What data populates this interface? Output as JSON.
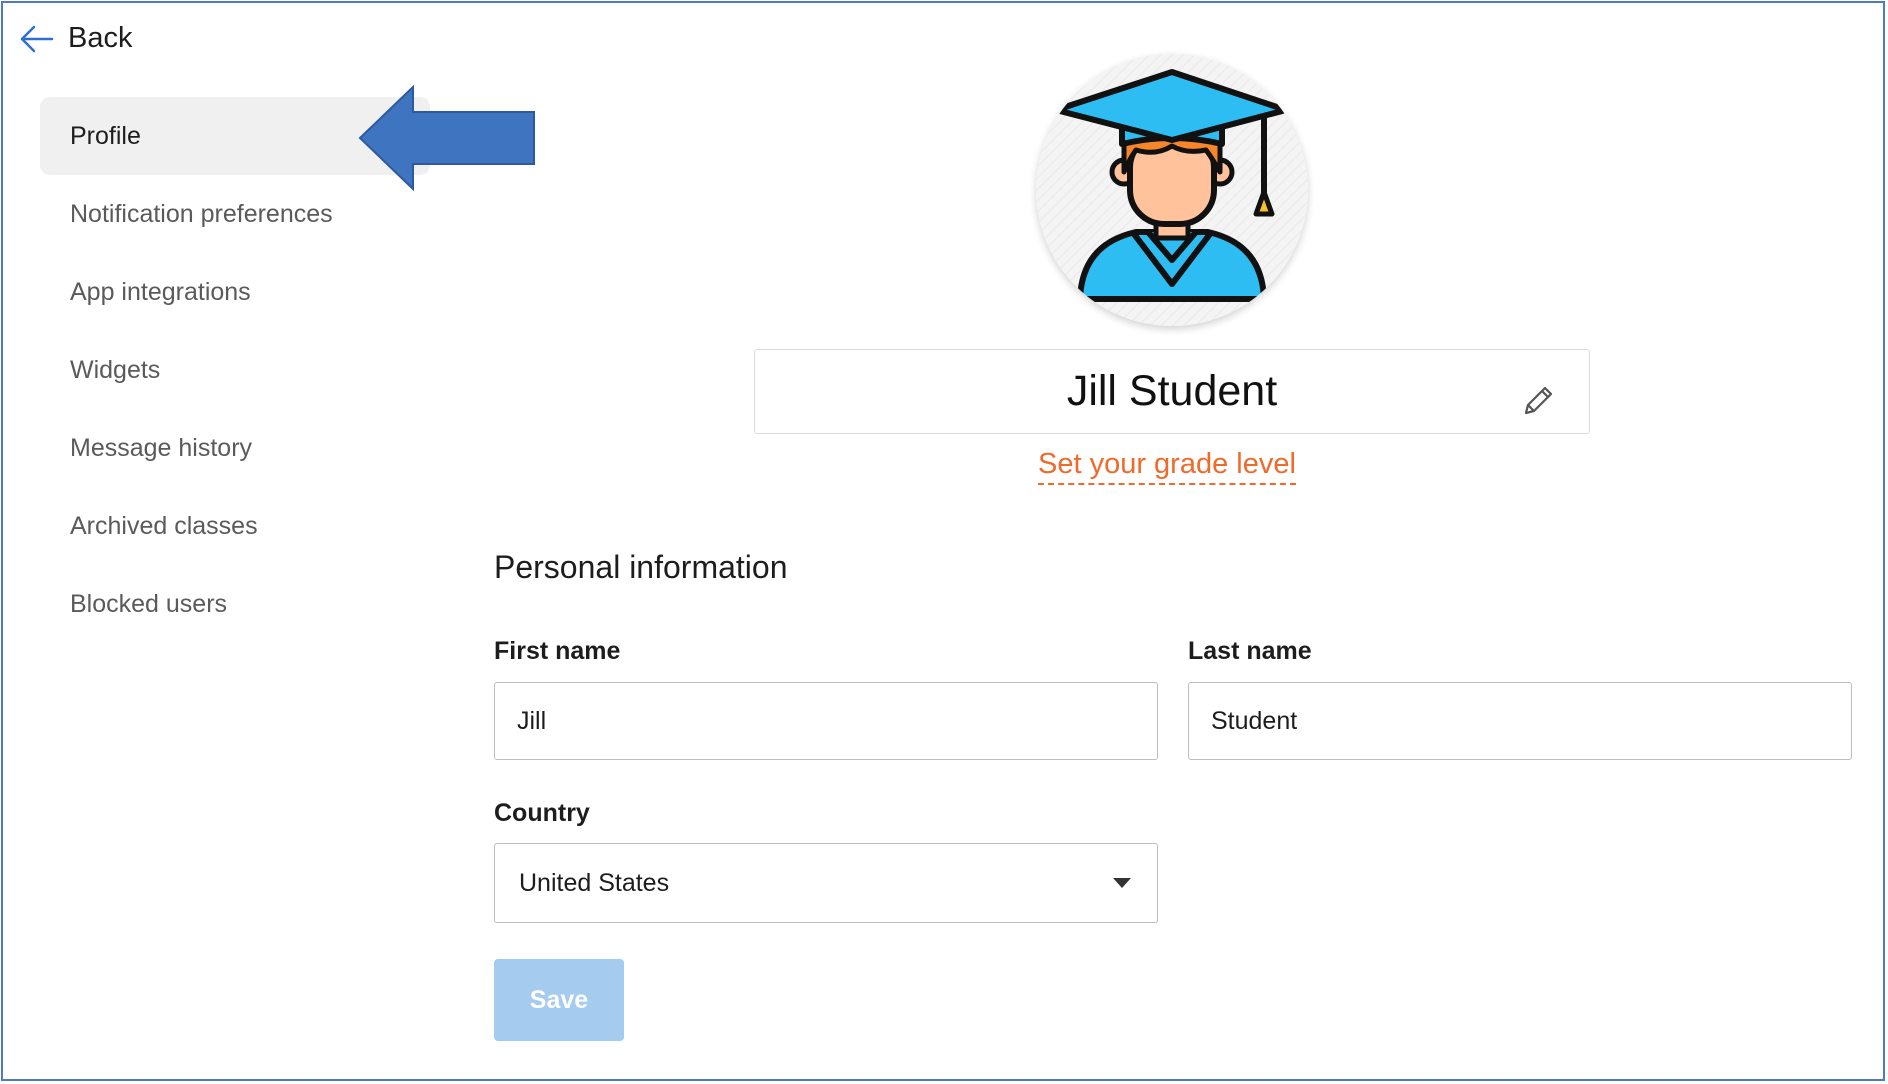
{
  "nav": {
    "back_label": "Back",
    "items": [
      {
        "label": "Profile",
        "active": true
      },
      {
        "label": "Notification preferences"
      },
      {
        "label": "App integrations"
      },
      {
        "label": "Widgets"
      },
      {
        "label": "Message history"
      },
      {
        "label": "Archived classes"
      },
      {
        "label": "Blocked users"
      }
    ]
  },
  "profile": {
    "display_name": "Jill Student",
    "grade_link": "Set your grade level",
    "avatar_icon": "graduate-avatar-icon",
    "edit_icon": "pencil-icon"
  },
  "personal_info": {
    "title": "Personal information",
    "first_name_label": "First name",
    "first_name_value": "Jill",
    "last_name_label": "Last name",
    "last_name_value": "Student",
    "country_label": "Country",
    "country_value": "United States",
    "save_label": "Save"
  },
  "colors": {
    "accent_orange": "#ef6a2b",
    "save_disabled": "#a5cbef",
    "annotation_arrow": "#3f74c0",
    "frame_border": "#4f7bbd"
  }
}
